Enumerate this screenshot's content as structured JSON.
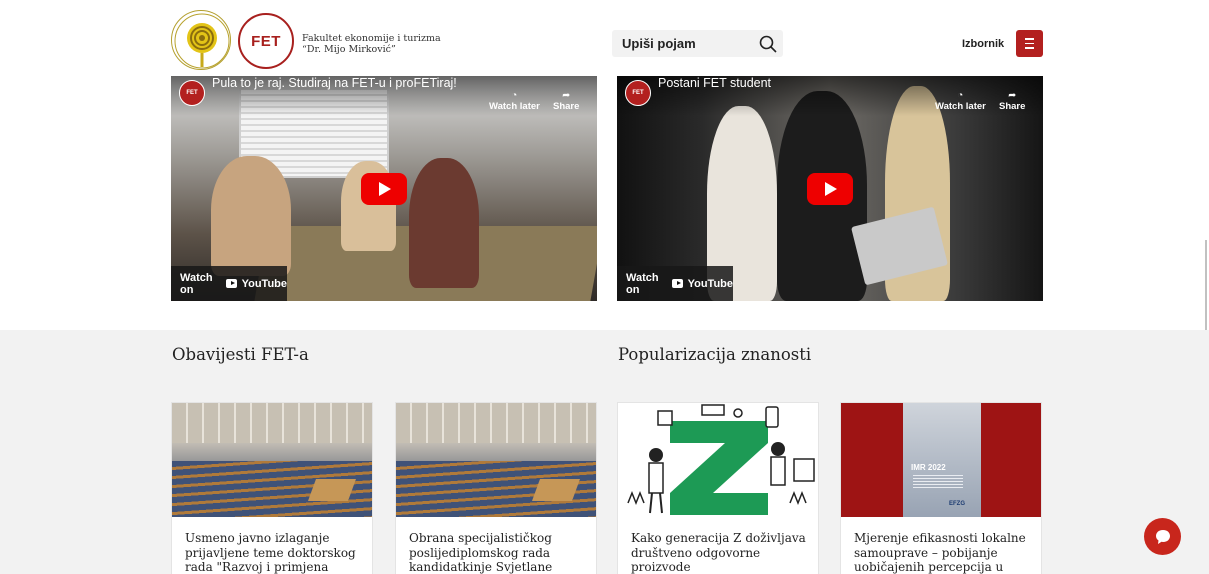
{
  "header": {
    "university_logo_text": "SVEUČILIŠTE JURJA DOBRILE U PULI",
    "faculty_badge": "FET",
    "faculty_name_line1": "Fakultet ekonomije i turizma",
    "faculty_name_line2": "“Dr. Mijo Mirković”",
    "search_placeholder": "Upiši pojam",
    "menu_label": "Izbornik"
  },
  "videos": [
    {
      "channel_badge": "FET",
      "title": "Pula to je raj. Studiraj na FET-u i proFETiraj!",
      "watch_later": "Watch later",
      "share": "Share",
      "watch_on": "Watch on",
      "platform": "YouTube"
    },
    {
      "channel_badge": "FET",
      "title": "Postani FET student",
      "watch_later": "Watch later",
      "share": "Share",
      "watch_on": "Watch on",
      "platform": "YouTube"
    }
  ],
  "sections": {
    "notices_title": "Obavijesti FET-a",
    "popularization_title": "Popularizacija znanosti"
  },
  "cards": [
    {
      "image": "lecture-hall",
      "text": "Usmeno javno izlaganje prijavljene teme doktorskog rada \"Razvoj i primjena"
    },
    {
      "image": "lecture-hall",
      "text": "Obrana specijalističkog poslijediplomskog rada kandidatkinje Svjetlane Matić"
    },
    {
      "image": "generation-z-illustration",
      "text": "Kako generacija Z doživljava društveno odgovorne proizvode"
    },
    {
      "image": "report-cover",
      "text": "Mjerenje efikasnosti lokalne samouprave – pobijanje uobičajenih percepcija u",
      "report_title": "IMR 2022",
      "report_brand": "EFZG"
    }
  ],
  "colors": {
    "brand_red": "#b3201f",
    "section_bg": "#f2f2f2",
    "genz_green": "#1d9a55"
  },
  "icons": {
    "search": "search-icon",
    "menu": "hamburger-icon",
    "play": "play-icon",
    "chat": "chat-icon"
  }
}
